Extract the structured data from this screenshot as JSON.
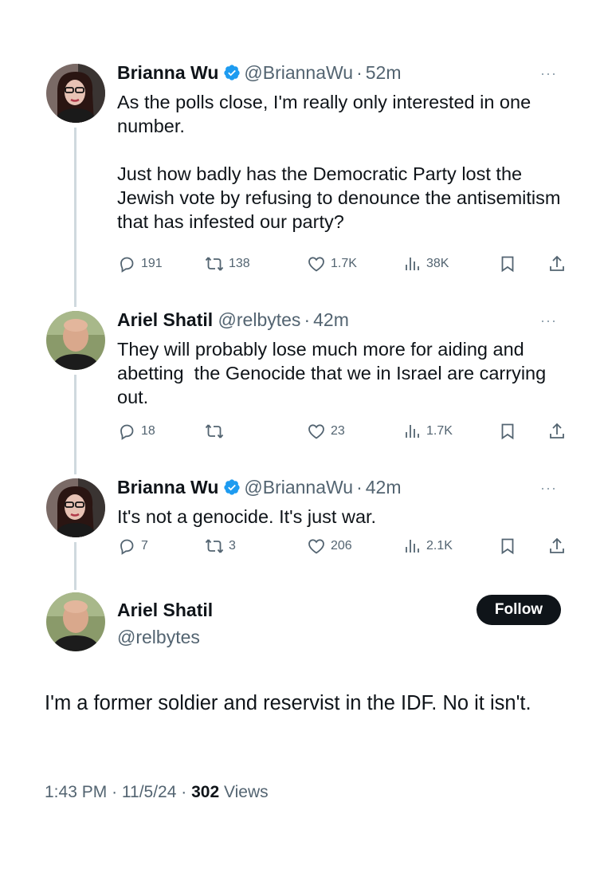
{
  "tweets": [
    {
      "name": "Brianna Wu",
      "handle": "@BriannaWu",
      "time": "52m",
      "verified": true,
      "text": "As the polls close, I'm really only interested in one number.\n\nJust how badly has the Democratic Party lost the Jewish vote by refusing to denounce the antisemitism that has infested our party?",
      "replies": "191",
      "reposts": "138",
      "likes": "1.7K",
      "views": "38K"
    },
    {
      "name": "Ariel Shatil",
      "handle": "@relbytes",
      "time": "42m",
      "verified": false,
      "text": "They will probably lose much more for aiding and abetting  the Genocide that we in Israel are carrying out.",
      "replies": "18",
      "reposts": "",
      "likes": "23",
      "views": "1.7K"
    },
    {
      "name": "Brianna Wu",
      "handle": "@BriannaWu",
      "time": "42m",
      "verified": true,
      "text": "It's not a genocide. It's just war.",
      "replies": "7",
      "reposts": "3",
      "likes": "206",
      "views": "2.1K"
    }
  ],
  "main_tweet": {
    "name": "Ariel Shatil",
    "handle": "@relbytes",
    "follow_label": "Follow",
    "text": "I'm a former soldier and reservist in the IDF. No it isn't.",
    "time": "1:43 PM",
    "date": "11/5/24",
    "views_count": "302",
    "views_label": "Views"
  },
  "more_label": "···",
  "separator": "·",
  "colors": {
    "verified": "#1d9bf0",
    "secondary_text": "#536471",
    "thread_line": "#cfd9de"
  }
}
